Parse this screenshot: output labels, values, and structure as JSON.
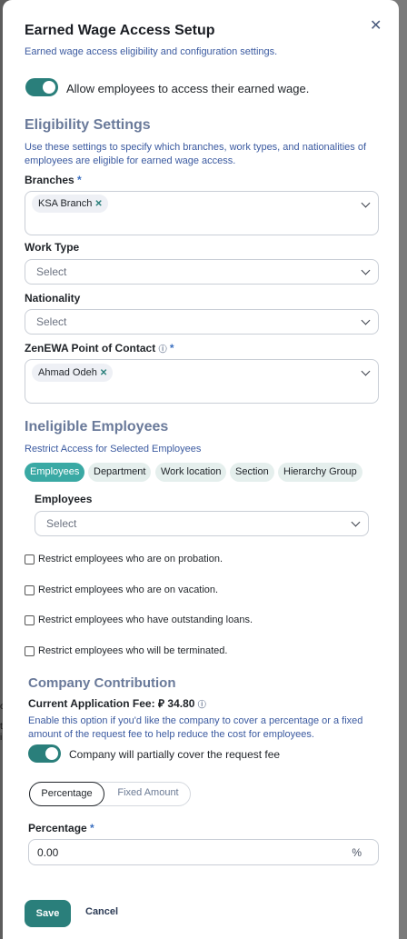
{
  "dialog": {
    "title": "Earned Wage Access Setup",
    "subtitle": "Earned wage access eligibility and configuration settings.",
    "close_icon": "close-icon",
    "allow_toggle_label": "Allow employees to access their earned wage.",
    "allow_toggle_on": true
  },
  "eligibility": {
    "title": "Eligibility Settings",
    "description": "Use these settings to specify which branches, work types, and nationalities of employees are eligible for earned wage access.",
    "branches_label": "Branches",
    "required_mark": "*",
    "branches_selected": [
      "KSA Branch"
    ],
    "work_type_label": "Work Type",
    "work_type_placeholder": "Select",
    "nationality_label": "Nationality",
    "nationality_placeholder": "Select",
    "contact_label": "ZenEWA Point of Contact",
    "contact_info_icon": "info-icon",
    "contact_selected": [
      "Ahmad Odeh"
    ]
  },
  "ineligible": {
    "title": "Ineligible Employees",
    "description": "Restrict Access for Selected Employees",
    "tabs": [
      "Employees",
      "Department",
      "Work location",
      "Section",
      "Hierarchy Group"
    ],
    "active_tab": "Employees",
    "employees_label": "Employees",
    "employees_placeholder": "Select",
    "restrictions": [
      "Restrict employees who are on probation.",
      "Restrict employees who are on vacation.",
      "Restrict employees who have outstanding loans.",
      "Restrict employees who will be terminated."
    ]
  },
  "contribution": {
    "title": "Company Contribution",
    "fee_label": "Current Application Fee:",
    "currency_symbol": "⃁",
    "fee_value": "34.80",
    "description": "Enable this option if you'd like the company to cover a percentage or a fixed amount of the request fee to help reduce the cost for employees.",
    "cover_toggle_label": "Company will partially cover the request fee",
    "cover_toggle_on": true,
    "modes": [
      "Percentage",
      "Fixed Amount"
    ],
    "active_mode": "Percentage",
    "percentage_label": "Percentage",
    "percentage_value": "0.00",
    "percentage_suffix": "%"
  },
  "actions": {
    "save": "Save",
    "cancel": "Cancel"
  },
  "colors": {
    "accent": "#2a7f7b",
    "tab_active": "#3aa9a4",
    "section_title": "#6a7a9a",
    "link_text": "#3b5aa0"
  }
}
